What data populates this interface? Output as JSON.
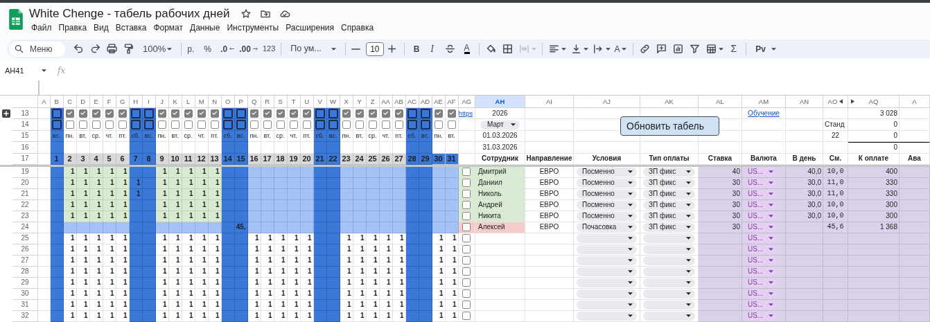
{
  "document": {
    "title": "White Chenge - табель рабочих дней"
  },
  "menu": [
    "Файл",
    "Правка",
    "Вид",
    "Вставка",
    "Формат",
    "Данные",
    "Инструменты",
    "Расширения",
    "Справка"
  ],
  "toolbar": {
    "search_placeholder": "Меню",
    "zoom": "100%",
    "currency": "р.",
    "percent": "%",
    "decrease_decimals": ".0",
    "increase_decimals": ".00",
    "number_format": "123",
    "font": "По ум...",
    "font_size": "10",
    "bold": "B",
    "italic": "I",
    "text_color": "A",
    "text_rotation": "A",
    "sum": "Σ",
    "input_tools": "Pv",
    "merge_disabled": true
  },
  "formula_bar": {
    "name_box": "AH41",
    "formula_label": "fx"
  },
  "columns": [
    {
      "letter": "A",
      "selected": false,
      "hidden_next": false
    },
    {
      "letter": "B",
      "selected": false,
      "hidden_next": false
    },
    {
      "letter": "C",
      "selected": false,
      "hidden_next": false
    },
    {
      "letter": "D",
      "selected": false,
      "hidden_next": false
    },
    {
      "letter": "E",
      "selected": false,
      "hidden_next": false
    },
    {
      "letter": "F",
      "selected": false,
      "hidden_next": false
    },
    {
      "letter": "G",
      "selected": false,
      "hidden_next": false
    },
    {
      "letter": "H",
      "selected": false,
      "hidden_next": false
    },
    {
      "letter": "I",
      "selected": false,
      "hidden_next": false
    },
    {
      "letter": "J",
      "selected": false,
      "hidden_next": false
    },
    {
      "letter": "K",
      "selected": false,
      "hidden_next": false
    },
    {
      "letter": "L",
      "selected": false,
      "hidden_next": false
    },
    {
      "letter": "M",
      "selected": false,
      "hidden_next": false
    },
    {
      "letter": "N",
      "selected": false,
      "hidden_next": false
    },
    {
      "letter": "O",
      "selected": false,
      "hidden_next": false
    },
    {
      "letter": "P",
      "selected": false,
      "hidden_next": false
    },
    {
      "letter": "Q",
      "selected": false,
      "hidden_next": false
    },
    {
      "letter": "R",
      "selected": false,
      "hidden_next": false
    },
    {
      "letter": "S",
      "selected": false,
      "hidden_next": false
    },
    {
      "letter": "T",
      "selected": false,
      "hidden_next": false
    },
    {
      "letter": "U",
      "selected": false,
      "hidden_next": false
    },
    {
      "letter": "V",
      "selected": false,
      "hidden_next": false
    },
    {
      "letter": "W",
      "selected": false,
      "hidden_next": false
    },
    {
      "letter": "X",
      "selected": false,
      "hidden_next": false
    },
    {
      "letter": "Y",
      "selected": false,
      "hidden_next": false
    },
    {
      "letter": "Z",
      "selected": false,
      "hidden_next": false
    },
    {
      "letter": "AA",
      "selected": false,
      "hidden_next": false
    },
    {
      "letter": "AB",
      "selected": false,
      "hidden_next": false
    },
    {
      "letter": "AC",
      "selected": false,
      "hidden_next": false
    },
    {
      "letter": "AD",
      "selected": false,
      "hidden_next": false
    },
    {
      "letter": "AE",
      "selected": false,
      "hidden_next": false
    },
    {
      "letter": "AF",
      "selected": false,
      "hidden_next": false
    },
    {
      "letter": "AG",
      "selected": false,
      "hidden_next": false
    },
    {
      "letter": "AH",
      "selected": true,
      "hidden_next": false
    },
    {
      "letter": "AI",
      "selected": false,
      "hidden_next": false
    },
    {
      "letter": "AJ",
      "selected": false,
      "hidden_next": false
    },
    {
      "letter": "AK",
      "selected": false,
      "hidden_next": false
    },
    {
      "letter": "AL",
      "selected": false,
      "hidden_next": false
    },
    {
      "letter": "AM",
      "selected": false,
      "hidden_next": false
    },
    {
      "letter": "AN",
      "selected": false,
      "hidden_next": false
    },
    {
      "letter": "AO",
      "selected": false,
      "hidden_next": true
    },
    {
      "letter": "AQ",
      "selected": false,
      "hidden_next": false
    },
    {
      "letter": "A",
      "selected": false,
      "hidden_next": false
    }
  ],
  "top_row_numbers": [
    "13",
    "14",
    "15",
    "16",
    "17"
  ],
  "days": [
    {
      "day": "1",
      "weekday": "вс.",
      "weekend": true,
      "color": "#3c78d8",
      "planned": false,
      "extra": false
    },
    {
      "day": "2",
      "weekday": "пн.",
      "weekend": false,
      "color": "#d9d9d9",
      "planned": true,
      "extra": false
    },
    {
      "day": "3",
      "weekday": "вт.",
      "weekend": false,
      "color": "#d9d9d9",
      "planned": true,
      "extra": false
    },
    {
      "day": "4",
      "weekday": "ср.",
      "weekend": false,
      "color": "#d9d9d9",
      "planned": true,
      "extra": false
    },
    {
      "day": "5",
      "weekday": "чт.",
      "weekend": false,
      "color": "#d9d9d9",
      "planned": true,
      "extra": false
    },
    {
      "day": "6",
      "weekday": "пт.",
      "weekend": false,
      "color": "#d9d9d9",
      "planned": true,
      "extra": false
    },
    {
      "day": "7",
      "weekday": "сб.",
      "weekend": true,
      "color": "#3c78d8",
      "planned": false,
      "extra": false
    },
    {
      "day": "8",
      "weekday": "вс.",
      "weekend": true,
      "color": "#3c78d8",
      "planned": false,
      "extra": false
    },
    {
      "day": "9",
      "weekday": "пн.",
      "weekend": false,
      "color": "#d9d9d9",
      "planned": true,
      "extra": false
    },
    {
      "day": "10",
      "weekday": "вт.",
      "weekend": false,
      "color": "#d9d9d9",
      "planned": true,
      "extra": false
    },
    {
      "day": "11",
      "weekday": "ср.",
      "weekend": false,
      "color": "#d9d9d9",
      "planned": true,
      "extra": false
    },
    {
      "day": "12",
      "weekday": "чт.",
      "weekend": false,
      "color": "#d9d9d9",
      "planned": true,
      "extra": false
    },
    {
      "day": "13",
      "weekday": "пт.",
      "weekend": false,
      "color": "#d9d9d9",
      "planned": true,
      "extra": false
    },
    {
      "day": "14",
      "weekday": "сб.",
      "weekend": true,
      "color": "#3c78d8",
      "planned": false,
      "extra": false
    },
    {
      "day": "15",
      "weekday": "вс.",
      "weekend": true,
      "color": "#3c78d8",
      "planned": false,
      "extra": false
    },
    {
      "day": "16",
      "weekday": "пн.",
      "weekend": false,
      "color": "#d9d9d9",
      "planned": true,
      "extra": false
    },
    {
      "day": "17",
      "weekday": "вт.",
      "weekend": false,
      "color": "#d9d9d9",
      "planned": true,
      "extra": false
    },
    {
      "day": "18",
      "weekday": "ср.",
      "weekend": false,
      "color": "#d9d9d9",
      "planned": true,
      "extra": false
    },
    {
      "day": "19",
      "weekday": "чт.",
      "weekend": false,
      "color": "#d9d9d9",
      "planned": true,
      "extra": false
    },
    {
      "day": "20",
      "weekday": "пт.",
      "weekend": false,
      "color": "#d9d9d9",
      "planned": true,
      "extra": false
    },
    {
      "day": "21",
      "weekday": "сб.",
      "weekend": true,
      "color": "#3c78d8",
      "planned": false,
      "extra": false
    },
    {
      "day": "22",
      "weekday": "вс.",
      "weekend": true,
      "color": "#3c78d8",
      "planned": false,
      "extra": false
    },
    {
      "day": "23",
      "weekday": "пн.",
      "weekend": false,
      "color": "#d9d9d9",
      "planned": true,
      "extra": false
    },
    {
      "day": "24",
      "weekday": "вт.",
      "weekend": false,
      "color": "#d9d9d9",
      "planned": true,
      "extra": false
    },
    {
      "day": "25",
      "weekday": "ср.",
      "weekend": false,
      "color": "#d9d9d9",
      "planned": true,
      "extra": false
    },
    {
      "day": "26",
      "weekday": "чт.",
      "weekend": false,
      "color": "#d9d9d9",
      "planned": true,
      "extra": false
    },
    {
      "day": "27",
      "weekday": "пт.",
      "weekend": false,
      "color": "#d9d9d9",
      "planned": true,
      "extra": false
    },
    {
      "day": "28",
      "weekday": "сб.",
      "weekend": true,
      "color": "#3c78d8",
      "planned": false,
      "extra": false
    },
    {
      "day": "29",
      "weekday": "вс.",
      "weekend": true,
      "color": "#3c78d8",
      "planned": false,
      "extra": false
    },
    {
      "day": "30",
      "weekday": "пн.",
      "weekend": false,
      "color": "#3c78d8",
      "planned": true,
      "extra": false
    },
    {
      "day": "31",
      "weekday": "вт.",
      "weekend": false,
      "color": "#3c78d8",
      "planned": true,
      "extra": false
    }
  ],
  "info": {
    "link": "https",
    "year": "2026",
    "month": "Март",
    "start": "01.03.2026",
    "end": "31.03.2026",
    "training_link": "Обучение",
    "norm_label": "Станд",
    "norm_days": "22",
    "totals": [
      "3 028",
      "0",
      "0",
      "0"
    ]
  },
  "refresh_button": "Обновить табель",
  "headers": [
    "Сотрудник",
    "Направление",
    "Условия",
    "Тип оплаты",
    "Ставка",
    "Валюта",
    "В день",
    "См.",
    "К оплате",
    "Ава"
  ],
  "rows": [
    {
      "number": "19",
      "kind": "employee",
      "checked": false,
      "color": "#d9ead3",
      "name": "Дмитрий",
      "direction": "ЕВРО",
      "conditions": "Посменно",
      "pay_type": "ЗП фикс",
      "rate": "40",
      "currency": "US...",
      "per_day": "40,0",
      "shifts": "10,0",
      "to_pay": "400",
      "days": [
        {
          "on": false
        },
        {
          "on": true,
          "value": "1"
        },
        {
          "on": true,
          "value": "1"
        },
        {
          "on": true,
          "value": "1"
        },
        {
          "on": true,
          "value": "1"
        },
        {
          "on": true,
          "value": "1"
        },
        {
          "on": false
        },
        {
          "on": false
        },
        {
          "on": true,
          "value": "1"
        },
        {
          "on": true,
          "value": "1"
        },
        {
          "on": true,
          "value": "1"
        },
        {
          "on": true,
          "value": "1"
        },
        {
          "on": true,
          "value": "1"
        },
        {
          "on": false
        },
        {
          "on": false
        },
        {
          "on": false
        },
        {
          "on": false
        },
        {
          "on": false
        },
        {
          "on": false
        },
        {
          "on": false
        },
        {
          "on": false
        },
        {
          "on": false
        },
        {
          "on": false
        },
        {
          "on": false
        },
        {
          "on": false
        },
        {
          "on": false
        },
        {
          "on": false
        },
        {
          "on": false
        },
        {
          "on": false
        },
        {
          "on": false
        },
        {
          "on": false
        }
      ]
    },
    {
      "number": "20",
      "kind": "employee",
      "checked": false,
      "color": "#d9ead3",
      "name": "Даниил",
      "direction": "ЕВРО",
      "conditions": "Посменно",
      "pay_type": "ЗП фикс",
      "rate": "30",
      "currency": "US...",
      "per_day": "30,0",
      "shifts": "11,0",
      "to_pay": "330",
      "days": [
        {
          "on": false
        },
        {
          "on": true,
          "value": "1"
        },
        {
          "on": true,
          "value": "1"
        },
        {
          "on": true,
          "value": "1"
        },
        {
          "on": true,
          "value": "1"
        },
        {
          "on": true,
          "value": "1"
        },
        {
          "on": true,
          "value": "1"
        },
        {
          "on": false
        },
        {
          "on": true,
          "value": "1"
        },
        {
          "on": true,
          "value": "1"
        },
        {
          "on": true,
          "value": "1"
        },
        {
          "on": true,
          "value": "1"
        },
        {
          "on": true,
          "value": "1"
        },
        {
          "on": false
        },
        {
          "on": false
        },
        {
          "on": false
        },
        {
          "on": false
        },
        {
          "on": false
        },
        {
          "on": false
        },
        {
          "on": false
        },
        {
          "on": false
        },
        {
          "on": false
        },
        {
          "on": false
        },
        {
          "on": false
        },
        {
          "on": false
        },
        {
          "on": false
        },
        {
          "on": false
        },
        {
          "on": false
        },
        {
          "on": false
        },
        {
          "on": false
        },
        {
          "on": false
        }
      ]
    },
    {
      "number": "21",
      "kind": "employee",
      "checked": false,
      "color": "#d9ead3",
      "name": "Николь",
      "direction": "ЕВРО",
      "conditions": "Посменно",
      "pay_type": "ЗП фикс",
      "rate": "30",
      "currency": "US...",
      "per_day": "30,0",
      "shifts": "11,0",
      "to_pay": "330",
      "days": [
        {
          "on": false
        },
        {
          "on": true,
          "value": "1"
        },
        {
          "on": true,
          "value": "1"
        },
        {
          "on": true,
          "value": "1"
        },
        {
          "on": true,
          "value": "1"
        },
        {
          "on": true,
          "value": "1"
        },
        {
          "on": true,
          "value": "1"
        },
        {
          "on": false
        },
        {
          "on": true,
          "value": "1"
        },
        {
          "on": true,
          "value": "1"
        },
        {
          "on": true,
          "value": "1"
        },
        {
          "on": true,
          "value": "1"
        },
        {
          "on": true,
          "value": "1"
        },
        {
          "on": false
        },
        {
          "on": false
        },
        {
          "on": false
        },
        {
          "on": false
        },
        {
          "on": false
        },
        {
          "on": false
        },
        {
          "on": false
        },
        {
          "on": false
        },
        {
          "on": false
        },
        {
          "on": false
        },
        {
          "on": false
        },
        {
          "on": false
        },
        {
          "on": false
        },
        {
          "on": false
        },
        {
          "on": false
        },
        {
          "on": false
        },
        {
          "on": false
        },
        {
          "on": false
        }
      ]
    },
    {
      "number": "22",
      "kind": "employee",
      "checked": false,
      "color": "#d9ead3",
      "name": "Андрей",
      "direction": "ЕВРО",
      "conditions": "Посменно",
      "pay_type": "ЗП фикс",
      "rate": "30",
      "currency": "US...",
      "per_day": "30,0",
      "shifts": "10,0",
      "to_pay": "300",
      "days": [
        {
          "on": false
        },
        {
          "on": true,
          "value": "1"
        },
        {
          "on": true,
          "value": "1"
        },
        {
          "on": true,
          "value": "1"
        },
        {
          "on": true,
          "value": "1"
        },
        {
          "on": true,
          "value": "1"
        },
        {
          "on": false
        },
        {
          "on": false
        },
        {
          "on": true,
          "value": "1"
        },
        {
          "on": true,
          "value": "1"
        },
        {
          "on": true,
          "value": "1"
        },
        {
          "on": true,
          "value": "1"
        },
        {
          "on": true,
          "value": "1"
        },
        {
          "on": false
        },
        {
          "on": false
        },
        {
          "on": false
        },
        {
          "on": false
        },
        {
          "on": false
        },
        {
          "on": false
        },
        {
          "on": false
        },
        {
          "on": false
        },
        {
          "on": false
        },
        {
          "on": false
        },
        {
          "on": false
        },
        {
          "on": false
        },
        {
          "on": false
        },
        {
          "on": false
        },
        {
          "on": false
        },
        {
          "on": false
        },
        {
          "on": false
        },
        {
          "on": false
        }
      ]
    },
    {
      "number": "23",
      "kind": "employee",
      "checked": false,
      "color": "#d9ead3",
      "name": "Никита",
      "direction": "ЕВРО",
      "conditions": "Посменно",
      "pay_type": "ЗП фикс",
      "rate": "30",
      "currency": "US...",
      "per_day": "30,0",
      "shifts": "10,0",
      "to_pay": "300",
      "days": [
        {
          "on": false
        },
        {
          "on": true,
          "value": "1"
        },
        {
          "on": true,
          "value": "1"
        },
        {
          "on": true,
          "value": "1"
        },
        {
          "on": true,
          "value": "1"
        },
        {
          "on": true,
          "value": "1"
        },
        {
          "on": false
        },
        {
          "on": false
        },
        {
          "on": true,
          "value": "1"
        },
        {
          "on": true,
          "value": "1"
        },
        {
          "on": true,
          "value": "1"
        },
        {
          "on": true,
          "value": "1"
        },
        {
          "on": true,
          "value": "1"
        },
        {
          "on": false
        },
        {
          "on": false
        },
        {
          "on": false
        },
        {
          "on": false
        },
        {
          "on": false
        },
        {
          "on": false
        },
        {
          "on": false
        },
        {
          "on": false
        },
        {
          "on": false
        },
        {
          "on": false
        },
        {
          "on": false
        },
        {
          "on": false
        },
        {
          "on": false
        },
        {
          "on": false
        },
        {
          "on": false
        },
        {
          "on": false
        },
        {
          "on": false
        },
        {
          "on": false
        }
      ]
    },
    {
      "number": "24",
      "kind": "employee",
      "checked": false,
      "color": "#f4cccc",
      "name": "Алексей",
      "direction": "ЕВРО",
      "conditions": "Почасовка",
      "pay_type": "ЗП фикс",
      "rate": "30",
      "currency": "US...",
      "shifts": "45,6",
      "to_pay": "1 368",
      "days": [
        {
          "on": false
        },
        {
          "on": false
        },
        {
          "on": false
        },
        {
          "on": false
        },
        {
          "on": false
        },
        {
          "on": false
        },
        {
          "on": false
        },
        {
          "on": false
        },
        {
          "on": false
        },
        {
          "on": false
        },
        {
          "on": false
        },
        {
          "on": false
        },
        {
          "on": false
        },
        {
          "on": false
        },
        {
          "on": true,
          "value": "45,"
        },
        {
          "on": false
        },
        {
          "on": false
        },
        {
          "on": false
        },
        {
          "on": false
        },
        {
          "on": false
        },
        {
          "on": false
        },
        {
          "on": false
        },
        {
          "on": false
        },
        {
          "on": false
        },
        {
          "on": false
        },
        {
          "on": false
        },
        {
          "on": false
        },
        {
          "on": false
        },
        {
          "on": false
        },
        {
          "on": false
        },
        {
          "on": false
        }
      ]
    },
    {
      "number": "25",
      "kind": "blank",
      "checked": false,
      "currency": "US...",
      "days": [
        {
          "on": false
        },
        {
          "on": true,
          "value": "1"
        },
        {
          "on": true,
          "value": "1"
        },
        {
          "on": true,
          "value": "1"
        },
        {
          "on": true,
          "value": "1"
        },
        {
          "on": true,
          "value": "1"
        },
        {
          "on": false
        },
        {
          "on": false
        },
        {
          "on": true,
          "value": "1"
        },
        {
          "on": true,
          "value": "1"
        },
        {
          "on": true,
          "value": "1"
        },
        {
          "on": true,
          "value": "1"
        },
        {
          "on": true,
          "value": "1"
        },
        {
          "on": false
        },
        {
          "on": false
        },
        {
          "on": true,
          "value": "1"
        },
        {
          "on": true,
          "value": "1"
        },
        {
          "on": true,
          "value": "1"
        },
        {
          "on": true,
          "value": "1"
        },
        {
          "on": true,
          "value": "1"
        },
        {
          "on": false
        },
        {
          "on": false
        },
        {
          "on": true,
          "value": "1"
        },
        {
          "on": true,
          "value": "1"
        },
        {
          "on": true,
          "value": "1"
        },
        {
          "on": true,
          "value": "1"
        },
        {
          "on": true,
          "value": "1"
        },
        {
          "on": false
        },
        {
          "on": false
        },
        {
          "on": true,
          "value": "1"
        },
        {
          "on": true,
          "value": "1"
        }
      ]
    },
    {
      "number": "26",
      "kind": "blank",
      "checked": false,
      "currency": "US...",
      "days": [
        {
          "on": false
        },
        {
          "on": true,
          "value": "1"
        },
        {
          "on": true,
          "value": "1"
        },
        {
          "on": true,
          "value": "1"
        },
        {
          "on": true,
          "value": "1"
        },
        {
          "on": true,
          "value": "1"
        },
        {
          "on": false
        },
        {
          "on": false
        },
        {
          "on": true,
          "value": "1"
        },
        {
          "on": true,
          "value": "1"
        },
        {
          "on": true,
          "value": "1"
        },
        {
          "on": true,
          "value": "1"
        },
        {
          "on": true,
          "value": "1"
        },
        {
          "on": false
        },
        {
          "on": false
        },
        {
          "on": true,
          "value": "1"
        },
        {
          "on": true,
          "value": "1"
        },
        {
          "on": true,
          "value": "1"
        },
        {
          "on": true,
          "value": "1"
        },
        {
          "on": true,
          "value": "1"
        },
        {
          "on": false
        },
        {
          "on": false
        },
        {
          "on": true,
          "value": "1"
        },
        {
          "on": true,
          "value": "1"
        },
        {
          "on": true,
          "value": "1"
        },
        {
          "on": true,
          "value": "1"
        },
        {
          "on": true,
          "value": "1"
        },
        {
          "on": false
        },
        {
          "on": false
        },
        {
          "on": true,
          "value": "1"
        },
        {
          "on": true,
          "value": "1"
        }
      ]
    },
    {
      "number": "27",
      "kind": "blank",
      "checked": false,
      "currency": "US...",
      "days": [
        {
          "on": false
        },
        {
          "on": true,
          "value": "1"
        },
        {
          "on": true,
          "value": "1"
        },
        {
          "on": true,
          "value": "1"
        },
        {
          "on": true,
          "value": "1"
        },
        {
          "on": true,
          "value": "1"
        },
        {
          "on": false
        },
        {
          "on": false
        },
        {
          "on": true,
          "value": "1"
        },
        {
          "on": true,
          "value": "1"
        },
        {
          "on": true,
          "value": "1"
        },
        {
          "on": true,
          "value": "1"
        },
        {
          "on": true,
          "value": "1"
        },
        {
          "on": false
        },
        {
          "on": false
        },
        {
          "on": true,
          "value": "1"
        },
        {
          "on": true,
          "value": "1"
        },
        {
          "on": true,
          "value": "1"
        },
        {
          "on": true,
          "value": "1"
        },
        {
          "on": true,
          "value": "1"
        },
        {
          "on": false
        },
        {
          "on": false
        },
        {
          "on": true,
          "value": "1"
        },
        {
          "on": true,
          "value": "1"
        },
        {
          "on": true,
          "value": "1"
        },
        {
          "on": true,
          "value": "1"
        },
        {
          "on": true,
          "value": "1"
        },
        {
          "on": false
        },
        {
          "on": false
        },
        {
          "on": true,
          "value": "1"
        },
        {
          "on": true,
          "value": "1"
        }
      ]
    },
    {
      "number": "28",
      "kind": "blank",
      "checked": false,
      "currency": "US...",
      "days": [
        {
          "on": false
        },
        {
          "on": true,
          "value": "1"
        },
        {
          "on": true,
          "value": "1"
        },
        {
          "on": true,
          "value": "1"
        },
        {
          "on": true,
          "value": "1"
        },
        {
          "on": true,
          "value": "1"
        },
        {
          "on": false
        },
        {
          "on": false
        },
        {
          "on": true,
          "value": "1"
        },
        {
          "on": true,
          "value": "1"
        },
        {
          "on": true,
          "value": "1"
        },
        {
          "on": true,
          "value": "1"
        },
        {
          "on": true,
          "value": "1"
        },
        {
          "on": false
        },
        {
          "on": false
        },
        {
          "on": true,
          "value": "1"
        },
        {
          "on": true,
          "value": "1"
        },
        {
          "on": true,
          "value": "1"
        },
        {
          "on": true,
          "value": "1"
        },
        {
          "on": true,
          "value": "1"
        },
        {
          "on": false
        },
        {
          "on": false
        },
        {
          "on": true,
          "value": "1"
        },
        {
          "on": true,
          "value": "1"
        },
        {
          "on": true,
          "value": "1"
        },
        {
          "on": true,
          "value": "1"
        },
        {
          "on": true,
          "value": "1"
        },
        {
          "on": false
        },
        {
          "on": false
        },
        {
          "on": true,
          "value": "1"
        },
        {
          "on": true,
          "value": "1"
        }
      ]
    },
    {
      "number": "29",
      "kind": "blank",
      "checked": false,
      "currency": "US...",
      "days": [
        {
          "on": false
        },
        {
          "on": true,
          "value": "1"
        },
        {
          "on": true,
          "value": "1"
        },
        {
          "on": true,
          "value": "1"
        },
        {
          "on": true,
          "value": "1"
        },
        {
          "on": true,
          "value": "1"
        },
        {
          "on": false
        },
        {
          "on": false
        },
        {
          "on": true,
          "value": "1"
        },
        {
          "on": true,
          "value": "1"
        },
        {
          "on": true,
          "value": "1"
        },
        {
          "on": true,
          "value": "1"
        },
        {
          "on": true,
          "value": "1"
        },
        {
          "on": false
        },
        {
          "on": false
        },
        {
          "on": true,
          "value": "1"
        },
        {
          "on": true,
          "value": "1"
        },
        {
          "on": true,
          "value": "1"
        },
        {
          "on": true,
          "value": "1"
        },
        {
          "on": true,
          "value": "1"
        },
        {
          "on": false
        },
        {
          "on": false
        },
        {
          "on": true,
          "value": "1"
        },
        {
          "on": true,
          "value": "1"
        },
        {
          "on": true,
          "value": "1"
        },
        {
          "on": true,
          "value": "1"
        },
        {
          "on": true,
          "value": "1"
        },
        {
          "on": false
        },
        {
          "on": false
        },
        {
          "on": true,
          "value": "1"
        },
        {
          "on": true,
          "value": "1"
        }
      ]
    },
    {
      "number": "30",
      "kind": "blank",
      "checked": false,
      "currency": "US...",
      "days": [
        {
          "on": false
        },
        {
          "on": true,
          "value": "1"
        },
        {
          "on": true,
          "value": "1"
        },
        {
          "on": true,
          "value": "1"
        },
        {
          "on": true,
          "value": "1"
        },
        {
          "on": true,
          "value": "1"
        },
        {
          "on": false
        },
        {
          "on": false
        },
        {
          "on": true,
          "value": "1"
        },
        {
          "on": true,
          "value": "1"
        },
        {
          "on": true,
          "value": "1"
        },
        {
          "on": true,
          "value": "1"
        },
        {
          "on": true,
          "value": "1"
        },
        {
          "on": false
        },
        {
          "on": false
        },
        {
          "on": true,
          "value": "1"
        },
        {
          "on": true,
          "value": "1"
        },
        {
          "on": true,
          "value": "1"
        },
        {
          "on": true,
          "value": "1"
        },
        {
          "on": true,
          "value": "1"
        },
        {
          "on": false
        },
        {
          "on": false
        },
        {
          "on": true,
          "value": "1"
        },
        {
          "on": true,
          "value": "1"
        },
        {
          "on": true,
          "value": "1"
        },
        {
          "on": true,
          "value": "1"
        },
        {
          "on": true,
          "value": "1"
        },
        {
          "on": false
        },
        {
          "on": false
        },
        {
          "on": true,
          "value": "1"
        },
        {
          "on": true,
          "value": "1"
        }
      ]
    },
    {
      "number": "31",
      "kind": "blank",
      "checked": false,
      "currency": "US...",
      "days": [
        {
          "on": false
        },
        {
          "on": true,
          "value": "1"
        },
        {
          "on": true,
          "value": "1"
        },
        {
          "on": true,
          "value": "1"
        },
        {
          "on": true,
          "value": "1"
        },
        {
          "on": true,
          "value": "1"
        },
        {
          "on": false
        },
        {
          "on": false
        },
        {
          "on": true,
          "value": "1"
        },
        {
          "on": true,
          "value": "1"
        },
        {
          "on": true,
          "value": "1"
        },
        {
          "on": true,
          "value": "1"
        },
        {
          "on": true,
          "value": "1"
        },
        {
          "on": false
        },
        {
          "on": false
        },
        {
          "on": true,
          "value": "1"
        },
        {
          "on": true,
          "value": "1"
        },
        {
          "on": true,
          "value": "1"
        },
        {
          "on": true,
          "value": "1"
        },
        {
          "on": true,
          "value": "1"
        },
        {
          "on": false
        },
        {
          "on": false
        },
        {
          "on": true,
          "value": "1"
        },
        {
          "on": true,
          "value": "1"
        },
        {
          "on": true,
          "value": "1"
        },
        {
          "on": true,
          "value": "1"
        },
        {
          "on": true,
          "value": "1"
        },
        {
          "on": false
        },
        {
          "on": false
        },
        {
          "on": true,
          "value": "1"
        },
        {
          "on": true,
          "value": "1"
        }
      ]
    },
    {
      "number": "32",
      "kind": "blank",
      "checked": false,
      "currency": "US...",
      "days": [
        {
          "on": false
        },
        {
          "on": true,
          "value": "1"
        },
        {
          "on": true,
          "value": "1"
        },
        {
          "on": true,
          "value": "1"
        },
        {
          "on": true,
          "value": "1"
        },
        {
          "on": true,
          "value": "1"
        },
        {
          "on": false
        },
        {
          "on": false
        },
        {
          "on": true,
          "value": "1"
        },
        {
          "on": true,
          "value": "1"
        },
        {
          "on": true,
          "value": "1"
        },
        {
          "on": true,
          "value": "1"
        },
        {
          "on": true,
          "value": "1"
        },
        {
          "on": false
        },
        {
          "on": false
        },
        {
          "on": true,
          "value": "1"
        },
        {
          "on": true,
          "value": "1"
        },
        {
          "on": true,
          "value": "1"
        },
        {
          "on": true,
          "value": "1"
        },
        {
          "on": true,
          "value": "1"
        },
        {
          "on": false
        },
        {
          "on": false
        },
        {
          "on": true,
          "value": "1"
        },
        {
          "on": true,
          "value": "1"
        },
        {
          "on": true,
          "value": "1"
        },
        {
          "on": true,
          "value": "1"
        },
        {
          "on": true,
          "value": "1"
        },
        {
          "on": false
        },
        {
          "on": false
        },
        {
          "on": true,
          "value": "1"
        },
        {
          "on": true,
          "value": "1"
        }
      ]
    }
  ]
}
